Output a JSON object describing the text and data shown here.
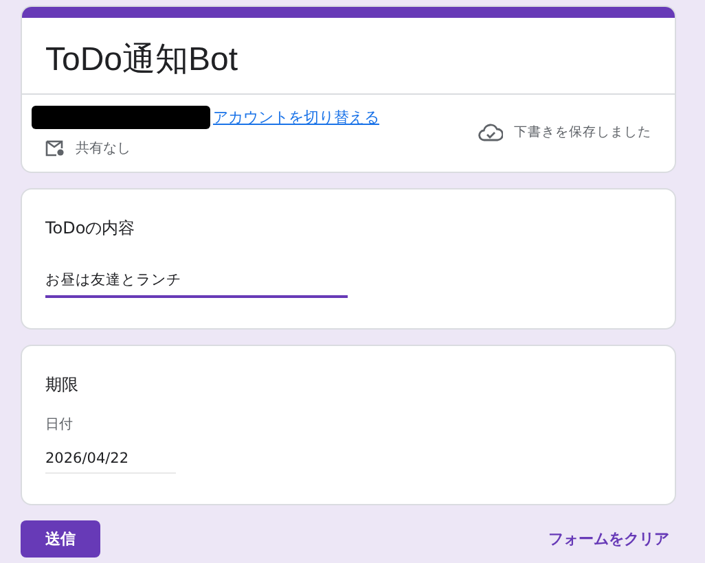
{
  "header": {
    "title": "ToDo通知Bot",
    "switch_account_link": "アカウントを切り替える",
    "sharing": "共有なし",
    "save_status": "下書きを保存しました"
  },
  "questions": [
    {
      "kind": "text",
      "title": "ToDoの内容",
      "value": "お昼は友達とランチ",
      "focused": true
    },
    {
      "kind": "date",
      "title": "期限",
      "sublabel": "日付",
      "value": "2026/04/22",
      "focused": false
    }
  ],
  "submit_button": "送信",
  "clear_link": "フォームをクリア"
}
